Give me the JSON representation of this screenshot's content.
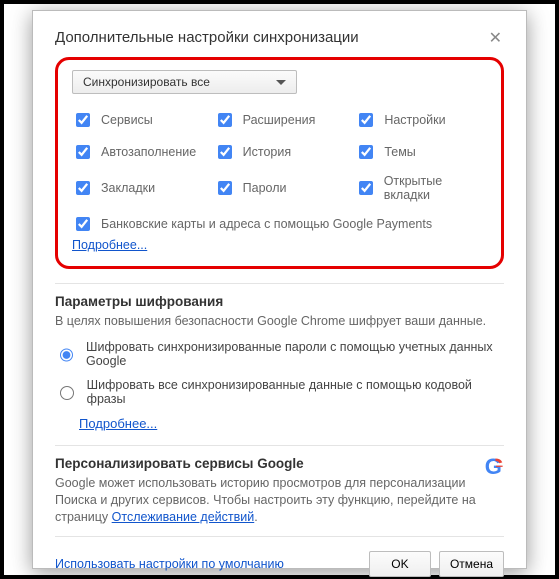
{
  "dialog": {
    "title": "Дополнительные настройки синхронизации"
  },
  "sync": {
    "dropdown_value": "Синхронизировать все",
    "items": {
      "services": "Сервисы",
      "extensions": "Расширения",
      "settings": "Настройки",
      "autofill": "Автозаполнение",
      "history": "История",
      "themes": "Темы",
      "bookmarks": "Закладки",
      "passwords": "Пароли",
      "open_tabs": "Открытые вкладки",
      "payments": "Банковские карты и адреса с помощью Google Payments"
    },
    "learn_more": "Подробнее..."
  },
  "encryption": {
    "title": "Параметры шифрования",
    "desc": "В целях повышения безопасности Google Chrome шифрует ваши данные.",
    "opt_google": "Шифровать синхронизированные пароли с помощью учетных данных Google",
    "opt_passphrase": "Шифровать все синхронизированные данные с помощью кодовой фразы",
    "learn_more": "Подробнее..."
  },
  "personalize": {
    "title": "Персонализировать сервисы Google",
    "desc_a": "Google может использовать историю просмотров для персонализации Поиска и других сервисов. Чтобы настроить эту функцию, перейдите на страницу ",
    "activity_link": "Отслеживание действий",
    "desc_b": "."
  },
  "footer": {
    "reset": "Использовать настройки по умолчанию",
    "ok": "OK",
    "cancel": "Отмена"
  }
}
